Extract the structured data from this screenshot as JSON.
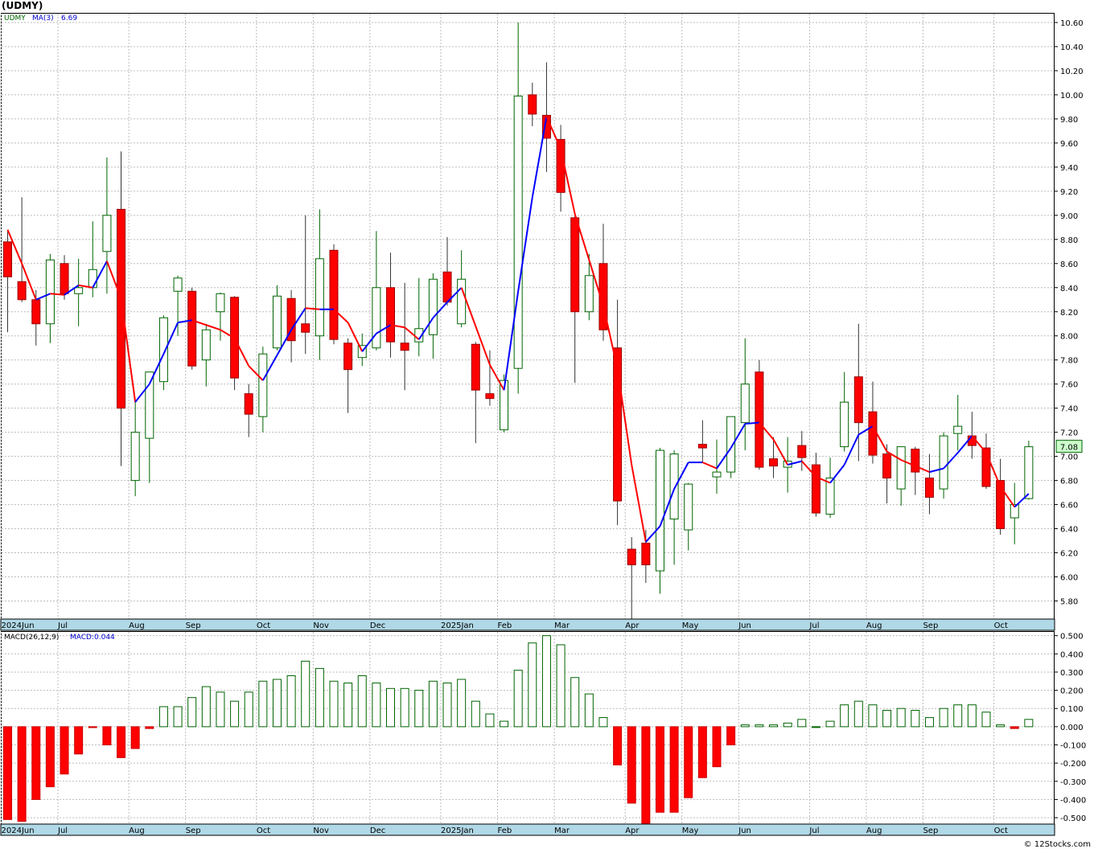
{
  "title": "(UDMY)",
  "credit": "© 12Stocks.com",
  "colors": {
    "up": "#006400",
    "down": "#ff0000",
    "ma_up": "#0000ff",
    "ma_down": "#ff0000",
    "grid": "#bbbbbb",
    "axis_band": "#b0d8e6"
  },
  "chart_data": [
    {
      "type": "candlestick",
      "symbol": "UDMY",
      "legend": {
        "symbol": "UDMY",
        "ma_label": "MA(3)",
        "ma_value": "6.69"
      },
      "last_price": "7.08",
      "ylim": [
        5.65,
        10.68
      ],
      "yticks": [
        "5.80",
        "6.00",
        "6.20",
        "6.40",
        "6.60",
        "6.80",
        "7.00",
        "7.20",
        "7.40",
        "7.60",
        "7.80",
        "8.00",
        "8.20",
        "8.40",
        "8.60",
        "8.80",
        "9.00",
        "9.20",
        "9.40",
        "9.60",
        "9.80",
        "10.00",
        "10.20",
        "10.40",
        "10.60"
      ],
      "month_labels": [
        {
          "label": "2024Jun",
          "bar": 0
        },
        {
          "label": "Jul",
          "bar": 4
        },
        {
          "label": "Aug",
          "bar": 9
        },
        {
          "label": "Sep",
          "bar": 13
        },
        {
          "label": "Oct",
          "bar": 18
        },
        {
          "label": "Nov",
          "bar": 22
        },
        {
          "label": "Dec",
          "bar": 26
        },
        {
          "label": "2025Jan",
          "bar": 31
        },
        {
          "label": "Feb",
          "bar": 35
        },
        {
          "label": "Mar",
          "bar": 39
        },
        {
          "label": "Apr",
          "bar": 44
        },
        {
          "label": "May",
          "bar": 48
        },
        {
          "label": "Jun",
          "bar": 52
        },
        {
          "label": "Jul",
          "bar": 57
        },
        {
          "label": "Aug",
          "bar": 61
        },
        {
          "label": "Sep",
          "bar": 65
        },
        {
          "label": "Oct",
          "bar": 70
        }
      ],
      "ohlc": [
        [
          8.78,
          8.88,
          8.03,
          8.49
        ],
        [
          8.45,
          9.15,
          8.28,
          8.3
        ],
        [
          8.3,
          8.38,
          7.92,
          8.1
        ],
        [
          8.1,
          8.68,
          7.94,
          8.63
        ],
        [
          8.6,
          8.67,
          8.3,
          8.35
        ],
        [
          8.35,
          8.64,
          8.08,
          8.4
        ],
        [
          8.4,
          8.95,
          8.32,
          8.55
        ],
        [
          8.7,
          9.48,
          8.35,
          9.0
        ],
        [
          9.05,
          9.53,
          6.92,
          7.4
        ],
        [
          6.8,
          7.45,
          6.67,
          7.2
        ],
        [
          7.15,
          7.7,
          6.78,
          7.7
        ],
        [
          7.62,
          8.17,
          7.55,
          8.15
        ],
        [
          8.37,
          8.5,
          8.0,
          8.48
        ],
        [
          8.37,
          8.4,
          7.72,
          7.75
        ],
        [
          7.8,
          8.1,
          7.58,
          8.05
        ],
        [
          8.2,
          8.36,
          7.96,
          8.35
        ],
        [
          8.32,
          8.33,
          7.55,
          7.65
        ],
        [
          7.52,
          7.6,
          7.16,
          7.35
        ],
        [
          7.33,
          7.91,
          7.2,
          7.85
        ],
        [
          7.9,
          8.42,
          7.88,
          8.33
        ],
        [
          8.31,
          8.38,
          7.78,
          7.96
        ],
        [
          8.1,
          9.0,
          7.85,
          8.03
        ],
        [
          8.0,
          9.05,
          7.8,
          8.64
        ],
        [
          8.71,
          8.76,
          7.93,
          7.97
        ],
        [
          7.94,
          7.98,
          7.36,
          7.72
        ],
        [
          7.82,
          8.02,
          7.75,
          7.92
        ],
        [
          7.9,
          8.87,
          7.88,
          8.4
        ],
        [
          8.4,
          8.69,
          7.82,
          7.95
        ],
        [
          7.94,
          8.44,
          7.55,
          7.88
        ],
        [
          7.95,
          8.48,
          7.83,
          8.06
        ],
        [
          8.01,
          8.52,
          7.81,
          8.47
        ],
        [
          8.53,
          8.82,
          8.25,
          8.28
        ],
        [
          8.1,
          8.71,
          8.07,
          8.47
        ],
        [
          7.93,
          7.95,
          7.11,
          7.55
        ],
        [
          7.52,
          7.88,
          7.42,
          7.48
        ],
        [
          7.22,
          7.68,
          7.2,
          7.63
        ],
        [
          7.73,
          10.6,
          7.52,
          9.99
        ],
        [
          10.0,
          10.1,
          9.74,
          9.84
        ],
        [
          9.83,
          10.27,
          9.36,
          9.64
        ],
        [
          9.63,
          9.75,
          9.03,
          9.19
        ],
        [
          8.98,
          9.02,
          7.61,
          8.2
        ],
        [
          8.2,
          8.68,
          8.13,
          8.5
        ],
        [
          8.6,
          8.93,
          7.96,
          8.05
        ],
        [
          7.9,
          8.3,
          6.43,
          6.63
        ],
        [
          6.23,
          6.33,
          5.65,
          6.1
        ],
        [
          6.28,
          6.39,
          5.95,
          6.1
        ],
        [
          6.05,
          7.07,
          5.86,
          7.05
        ],
        [
          6.48,
          7.05,
          6.1,
          7.02
        ],
        [
          6.39,
          6.78,
          6.22,
          6.77
        ],
        [
          7.1,
          7.3,
          6.95,
          7.07
        ],
        [
          6.83,
          7.14,
          6.69,
          6.87
        ],
        [
          6.87,
          7.31,
          6.82,
          7.33
        ],
        [
          7.28,
          7.98,
          7.05,
          7.6
        ],
        [
          7.7,
          7.8,
          6.89,
          6.91
        ],
        [
          6.98,
          7.16,
          6.82,
          6.92
        ],
        [
          6.91,
          7.16,
          6.7,
          6.96
        ],
        [
          7.09,
          7.21,
          6.88,
          6.99
        ],
        [
          6.93,
          7.03,
          6.5,
          6.53
        ],
        [
          6.52,
          6.99,
          6.49,
          6.82
        ],
        [
          7.08,
          7.7,
          7.04,
          7.45
        ],
        [
          7.66,
          8.1,
          6.96,
          7.28
        ],
        [
          7.37,
          7.62,
          6.94,
          7.01
        ],
        [
          7.02,
          7.1,
          6.61,
          6.82
        ],
        [
          6.73,
          7.06,
          6.59,
          7.08
        ],
        [
          7.06,
          7.08,
          6.68,
          6.87
        ],
        [
          6.82,
          7.02,
          6.52,
          6.66
        ],
        [
          6.73,
          7.2,
          6.65,
          7.17
        ],
        [
          7.19,
          7.51,
          7.05,
          7.25
        ],
        [
          7.17,
          7.37,
          6.98,
          7.09
        ],
        [
          7.07,
          7.19,
          6.73,
          6.75
        ],
        [
          6.8,
          6.98,
          6.35,
          6.4
        ],
        [
          6.49,
          6.78,
          6.27,
          6.6
        ],
        [
          6.65,
          7.13,
          6.64,
          7.08
        ]
      ],
      "ma": [
        8.88,
        8.6,
        8.3,
        8.35,
        8.34,
        8.42,
        8.4,
        8.62,
        8.31,
        7.45,
        7.6,
        7.85,
        8.11,
        8.13,
        8.09,
        8.05,
        7.98,
        7.75,
        7.63,
        7.84,
        8.05,
        8.23,
        8.22,
        8.22,
        8.11,
        7.87,
        8.02,
        8.09,
        8.07,
        7.97,
        8.15,
        8.28,
        8.4,
        8.08,
        7.76,
        7.55,
        8.37,
        9.15,
        9.82,
        9.55,
        9.01,
        8.63,
        8.25,
        7.73,
        6.93,
        6.29,
        6.42,
        6.73,
        6.95,
        6.95,
        6.9,
        7.07,
        7.27,
        7.28,
        7.14,
        6.93,
        6.96,
        6.83,
        6.78,
        6.93,
        7.18,
        7.25,
        7.04,
        6.97,
        6.92,
        6.87,
        6.9,
        7.03,
        7.17,
        7.03,
        6.75,
        6.58,
        6.69
      ]
    },
    {
      "type": "bar",
      "name": "MACD histogram",
      "legend": {
        "label": "MACD(26,12,9)",
        "value_label": "MACD:0.044"
      },
      "ylim": [
        -0.535,
        0.525
      ],
      "yticks": [
        "-0.500",
        "-0.400",
        "-0.300",
        "-0.200",
        "-0.100",
        "0.000",
        "0.100",
        "0.200",
        "0.300",
        "0.400",
        "0.500"
      ],
      "values": [
        -0.51,
        -0.52,
        -0.4,
        -0.33,
        -0.26,
        -0.15,
        -0.005,
        -0.1,
        -0.17,
        -0.12,
        -0.01,
        0.11,
        0.11,
        0.16,
        0.22,
        0.19,
        0.14,
        0.19,
        0.25,
        0.26,
        0.28,
        0.36,
        0.32,
        0.25,
        0.24,
        0.28,
        0.24,
        0.21,
        0.21,
        0.2,
        0.25,
        0.24,
        0.26,
        0.14,
        0.07,
        0.03,
        0.31,
        0.46,
        0.5,
        0.45,
        0.27,
        0.18,
        0.05,
        -0.21,
        -0.42,
        -0.54,
        -0.47,
        -0.47,
        -0.39,
        -0.28,
        -0.22,
        -0.1,
        0.01,
        0.01,
        0.01,
        0.02,
        0.04,
        0.0,
        0.03,
        0.12,
        0.14,
        0.12,
        0.09,
        0.1,
        0.09,
        0.05,
        0.1,
        0.12,
        0.12,
        0.08,
        0.01,
        -0.01,
        0.04
      ]
    }
  ]
}
